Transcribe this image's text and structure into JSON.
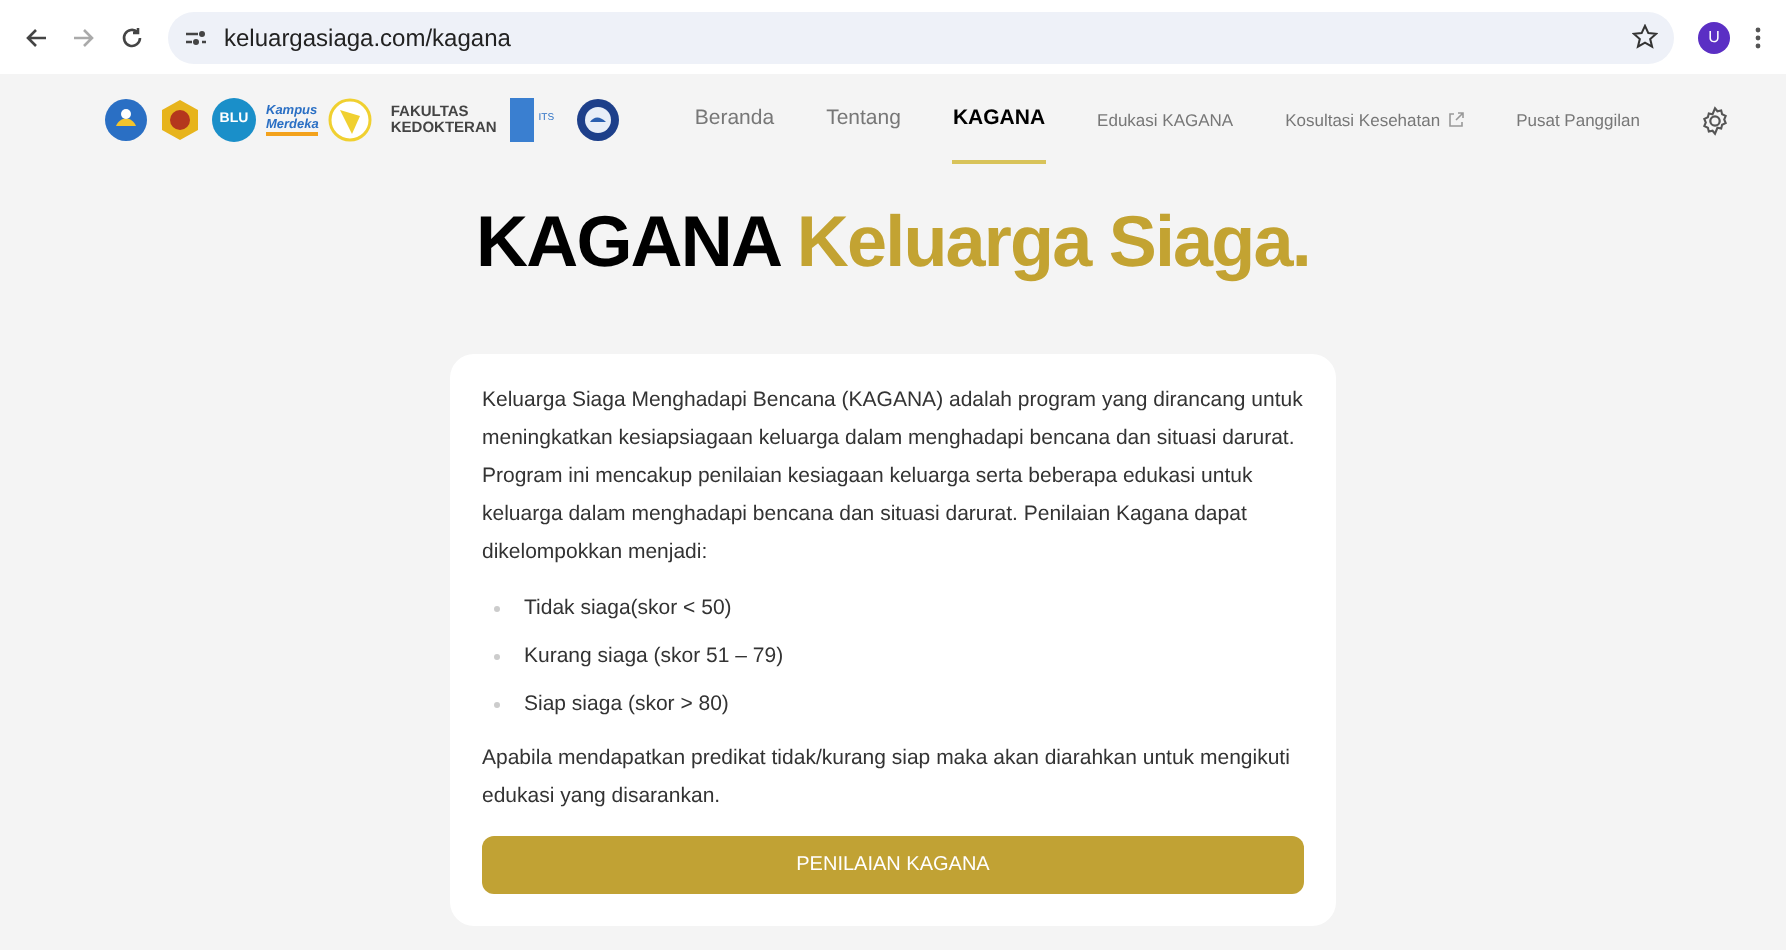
{
  "browser": {
    "url": "keluargasiaga.com/kagana",
    "avatar": "U"
  },
  "logos": [
    {
      "kind": "seal"
    },
    {
      "kind": "crest"
    },
    {
      "kind": "badge",
      "text": "BLU"
    },
    {
      "kind": "wordmark",
      "lines": [
        "Kampus",
        "Merdeka"
      ]
    },
    {
      "kind": "emblem"
    },
    {
      "kind": "faculty",
      "lines": [
        "FAKULTAS",
        "KEDOKTERAN"
      ]
    },
    {
      "kind": "its",
      "text": "ITS"
    },
    {
      "kind": "globe"
    }
  ],
  "nav": [
    {
      "label": "Beranda",
      "selected": false,
      "external": false
    },
    {
      "label": "Tentang",
      "selected": false,
      "external": false
    },
    {
      "label": "KAGANA",
      "selected": true,
      "external": false
    },
    {
      "label": "Edukasi KAGANA",
      "selected": false,
      "external": false
    },
    {
      "label": "Kosultasi Kesehatan",
      "selected": false,
      "external": true
    },
    {
      "label": "Pusat Panggilan",
      "selected": false,
      "external": false
    }
  ],
  "heading": {
    "main": "KAGANA",
    "accent": "Keluarga Siaga."
  },
  "card": {
    "intro": "Keluarga Siaga Menghadapi Bencana (KAGANA) adalah program yang dirancang untuk meningkatkan kesiapsiagaan keluarga dalam menghadapi bencana dan situasi darurat. Program ini mencakup penilaian kesiagaan keluarga serta beberapa edukasi untuk keluarga dalam menghadapi bencana dan situasi darurat. Penilaian Kagana dapat dikelompokkan menjadi:",
    "items": [
      "Tidak siaga(skor < 50)",
      "Kurang siaga (skor 51 – 79)",
      "Siap siaga (skor > 80)"
    ],
    "note": "Apabila mendapatkan predikat tidak/kurang siap maka akan diarahkan untuk mengikuti edukasi yang disarankan.",
    "button": "PENILAIAN KAGANA"
  }
}
